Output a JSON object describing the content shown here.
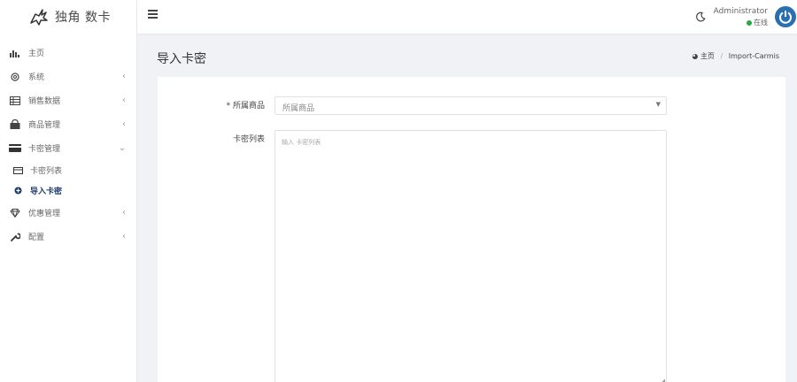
{
  "brand": {
    "name": "独角 数卡"
  },
  "sidebar": {
    "items": [
      {
        "label": "主页",
        "icon": "bar-chart-icon",
        "arrow": ""
      },
      {
        "label": "系统",
        "icon": "gear-icon",
        "arrow": "‹"
      },
      {
        "label": "销售数据",
        "icon": "table-icon",
        "arrow": "‹"
      },
      {
        "label": "商品管理",
        "icon": "shopping-bag-icon",
        "arrow": "‹"
      },
      {
        "label": "卡密管理",
        "icon": "credit-card-icon",
        "arrow": "⌄"
      }
    ],
    "subitems": [
      {
        "label": "卡密列表",
        "icon": "card-icon"
      },
      {
        "label": "导入卡密",
        "icon": "plus-circle-icon"
      }
    ],
    "items2": [
      {
        "label": "优惠管理",
        "icon": "diamond-icon",
        "arrow": "‹"
      },
      {
        "label": "配置",
        "icon": "wrench-icon",
        "arrow": "‹"
      }
    ]
  },
  "topbar": {
    "user_name": "Administrator",
    "user_status": "在线",
    "status_color": "#28a745",
    "avatar_color": "#2a6fb0"
  },
  "page": {
    "title": "导入卡密",
    "breadcrumb": {
      "home": "主页",
      "current": "Import-Carmis"
    }
  },
  "form": {
    "product_label": "* 所属商品",
    "product_value": "所属商品",
    "cards_label": "卡密列表",
    "cards_placeholder": "输入 卡密列表"
  }
}
